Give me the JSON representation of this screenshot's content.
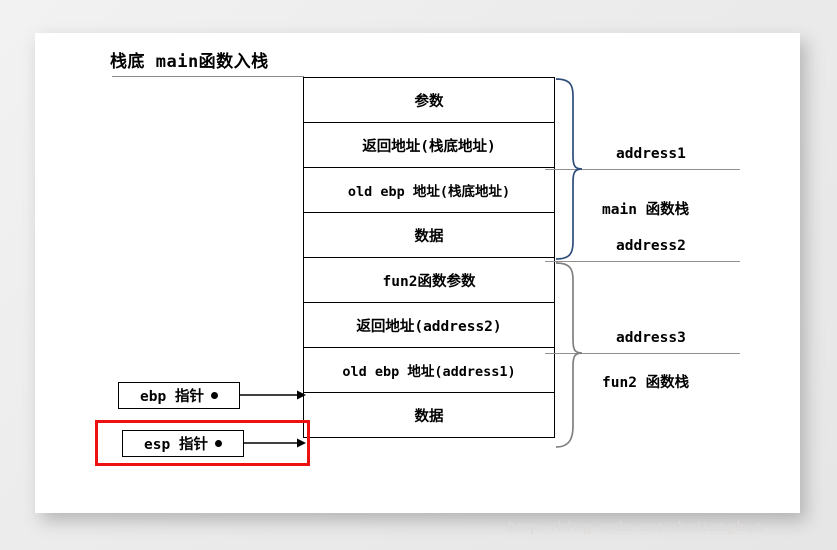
{
  "title": "栈底 main函数入栈",
  "watermark": "http://blog.csdn.net/shulianghan",
  "stack": {
    "rows": [
      {
        "label": "参数"
      },
      {
        "label": "返回地址(栈底地址)"
      },
      {
        "label": "old ebp 地址(栈底地址)"
      },
      {
        "label": "数据"
      },
      {
        "label": "fun2函数参数"
      },
      {
        "label": "返回地址(address2)"
      },
      {
        "label": "old ebp 地址(address1)"
      },
      {
        "label": "数据"
      }
    ]
  },
  "annotations": {
    "address1": "address1",
    "address2": "address2",
    "address3": "address3",
    "main_frame": "main 函数栈",
    "fun2_frame": "fun2 函数栈"
  },
  "pointers": {
    "ebp": "ebp 指针",
    "esp": "esp 指针"
  },
  "colors": {
    "brace_upper": "#2e4d7b",
    "brace_lower": "#808080",
    "highlight": "#ee1111",
    "rule": "#909090",
    "border": "#000000"
  }
}
